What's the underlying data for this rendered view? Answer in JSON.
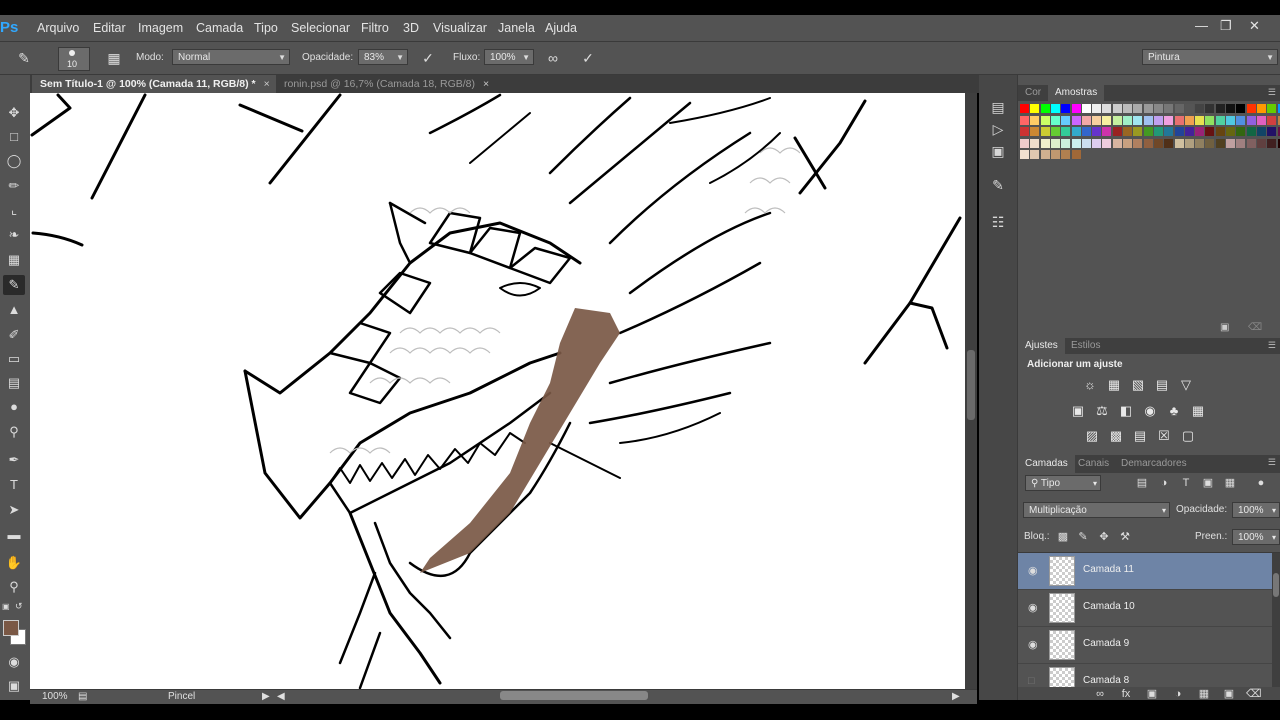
{
  "app": {
    "logo": "Ps"
  },
  "menu": [
    "Arquivo",
    "Editar",
    "Imagem",
    "Camada",
    "Tipo",
    "Selecionar",
    "Filtro",
    "3D",
    "Visualizar",
    "Janela",
    "Ajuda"
  ],
  "options": {
    "brush_size": "10",
    "mode_label": "Modo:",
    "mode_value": "Normal",
    "opacity_label": "Opacidade:",
    "opacity_value": "83%",
    "flow_label": "Fluxo:",
    "flow_value": "100%",
    "workspace": "Pintura"
  },
  "tabs": [
    {
      "label": "Sem Título-1 @ 100% (Camada 11, RGB/8) *"
    },
    {
      "label": "ronin.psd @ 16,7% (Camada 18, RGB/8)"
    }
  ],
  "status": {
    "zoom": "100%",
    "tool": "Pincel"
  },
  "colors": {
    "foreground": "#7a5845",
    "background": "#ffffff",
    "selection": "#6e84a6"
  },
  "swatch_panel": {
    "tab_cor": "Cor",
    "tab_amostras": "Amostras"
  },
  "adjust_panel": {
    "tab_ajustes": "Ajustes",
    "tab_estilos": "Estilos",
    "title": "Adicionar um ajuste"
  },
  "layers_panel": {
    "tab_camadas": "Camadas",
    "tab_canais": "Canais",
    "tab_demarcadores": "Demarcadores",
    "filter": "Tipo",
    "blend_mode": "Multiplicação",
    "opacity_label": "Opacidade:",
    "opacity_value": "100%",
    "lock_label": "Bloq.:",
    "fill_label": "Preen.:",
    "fill_value": "100%",
    "layers": [
      {
        "name": "Camada 11",
        "selected": true
      },
      {
        "name": "Camada 10",
        "selected": false
      },
      {
        "name": "Camada 9",
        "selected": false
      },
      {
        "name": "Camada 8",
        "selected": false
      }
    ]
  }
}
